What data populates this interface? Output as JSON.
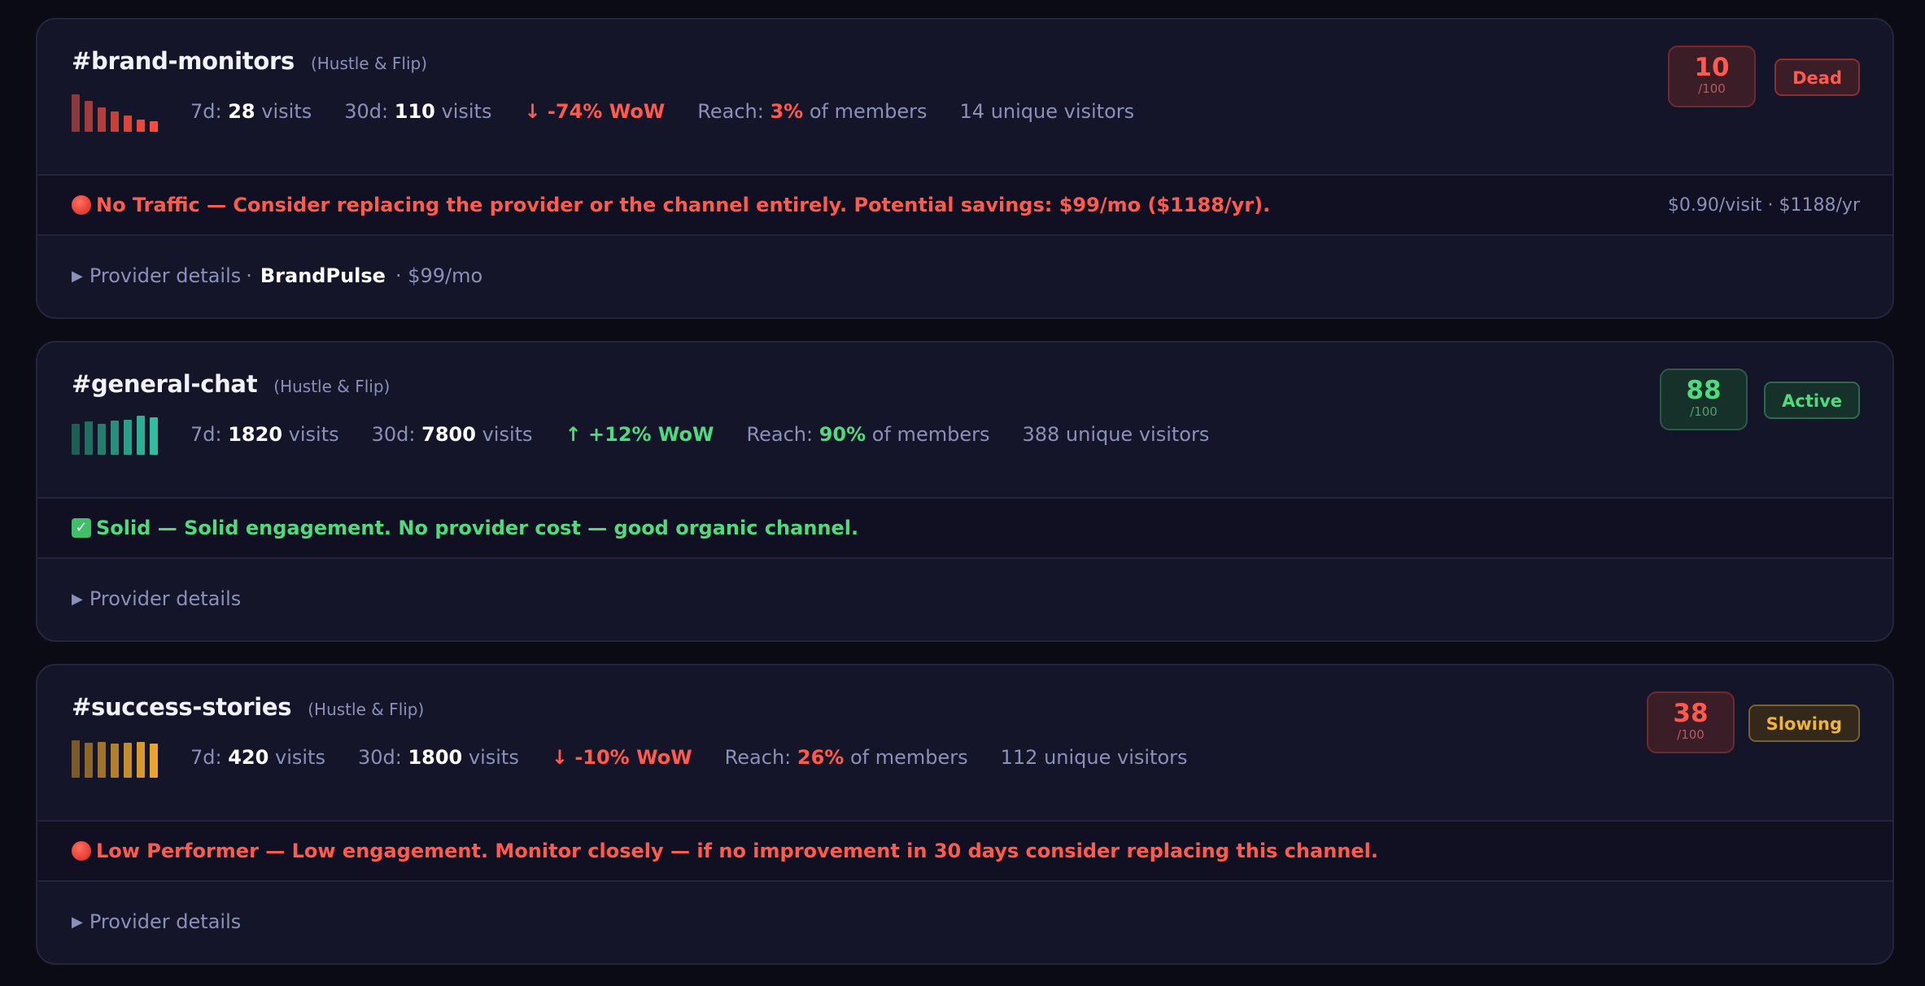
{
  "channels": [
    {
      "name": "#brand-monitors",
      "org": "(Hustle & Flip)",
      "visits7d_label": "7d:",
      "visits7d": "28",
      "visits_word": "visits",
      "visits30d_label": "30d:",
      "visits30d": "110",
      "trend": "↓ -74% WoW",
      "reach_label": "Reach:",
      "reach": "3%",
      "reach_suffix": "of members",
      "unique": "14 unique visitors",
      "score": "10",
      "score_den": "/100",
      "status": "Dead",
      "alert": "No Traffic — Consider replacing the provider or the channel entirely. Potential savings: $99/mo ($1188/yr).",
      "alert_right": "$0.90/visit · $1188/yr",
      "details_label": "Provider details",
      "provider_sep": "·",
      "provider": "BrandPulse",
      "provider_cost": "· $99/mo",
      "spark": [
        0.95,
        0.8,
        0.62,
        0.52,
        0.42,
        0.32,
        0.28
      ],
      "colors": {
        "accent": "#ff5a4e",
        "spark_from": "#8a3a3a",
        "spark_to": "#ff4a3d",
        "badge_bg": "#3a1d26",
        "badge_border": "#6e2a30"
      }
    },
    {
      "name": "#general-chat",
      "org": "(Hustle & Flip)",
      "visits7d_label": "7d:",
      "visits7d": "1820",
      "visits_word": "visits",
      "visits30d_label": "30d:",
      "visits30d": "7800",
      "trend": "↑ +12% WoW",
      "reach_label": "Reach:",
      "reach": "90%",
      "reach_suffix": "of members",
      "unique": "388 unique visitors",
      "score": "88",
      "score_den": "/100",
      "status": "Active",
      "alert": "Solid — Solid engagement. No provider cost — good organic channel.",
      "details_label": "Provider details",
      "spark": [
        0.8,
        0.85,
        0.8,
        0.88,
        0.9,
        1.0,
        0.95
      ],
      "colors": {
        "accent": "#4ddb7e",
        "spark_from": "#1e5e55",
        "spark_to": "#2fbfa0",
        "badge_bg": "#16302a",
        "badge_border": "#2c6a4e"
      }
    },
    {
      "name": "#success-stories",
      "org": "(Hustle & Flip)",
      "visits7d_label": "7d:",
      "visits7d": "420",
      "visits_word": "visits",
      "visits30d_label": "30d:",
      "visits30d": "1800",
      "trend": "↓ -10% WoW",
      "reach_label": "Reach:",
      "reach": "26%",
      "reach_suffix": "of members",
      "unique": "112 unique visitors",
      "score": "38",
      "score_den": "/100",
      "status": "Slowing",
      "alert": "Low Performer — Low engagement. Monitor closely — if no improvement in 30 days consider replacing this channel.",
      "details_label": "Provider details",
      "spark": [
        0.95,
        0.9,
        0.92,
        0.88,
        0.9,
        0.92,
        0.88
      ],
      "colors": {
        "accent": "#ff5a4e",
        "spark_from": "#7a5a28",
        "spark_to": "#e8a630",
        "badge_bg": "#3a1d26",
        "badge_border": "#6e2a30",
        "status_color": "#f0b43a",
        "status_bg": "#33291a",
        "status_border": "#7a6030"
      }
    }
  ]
}
